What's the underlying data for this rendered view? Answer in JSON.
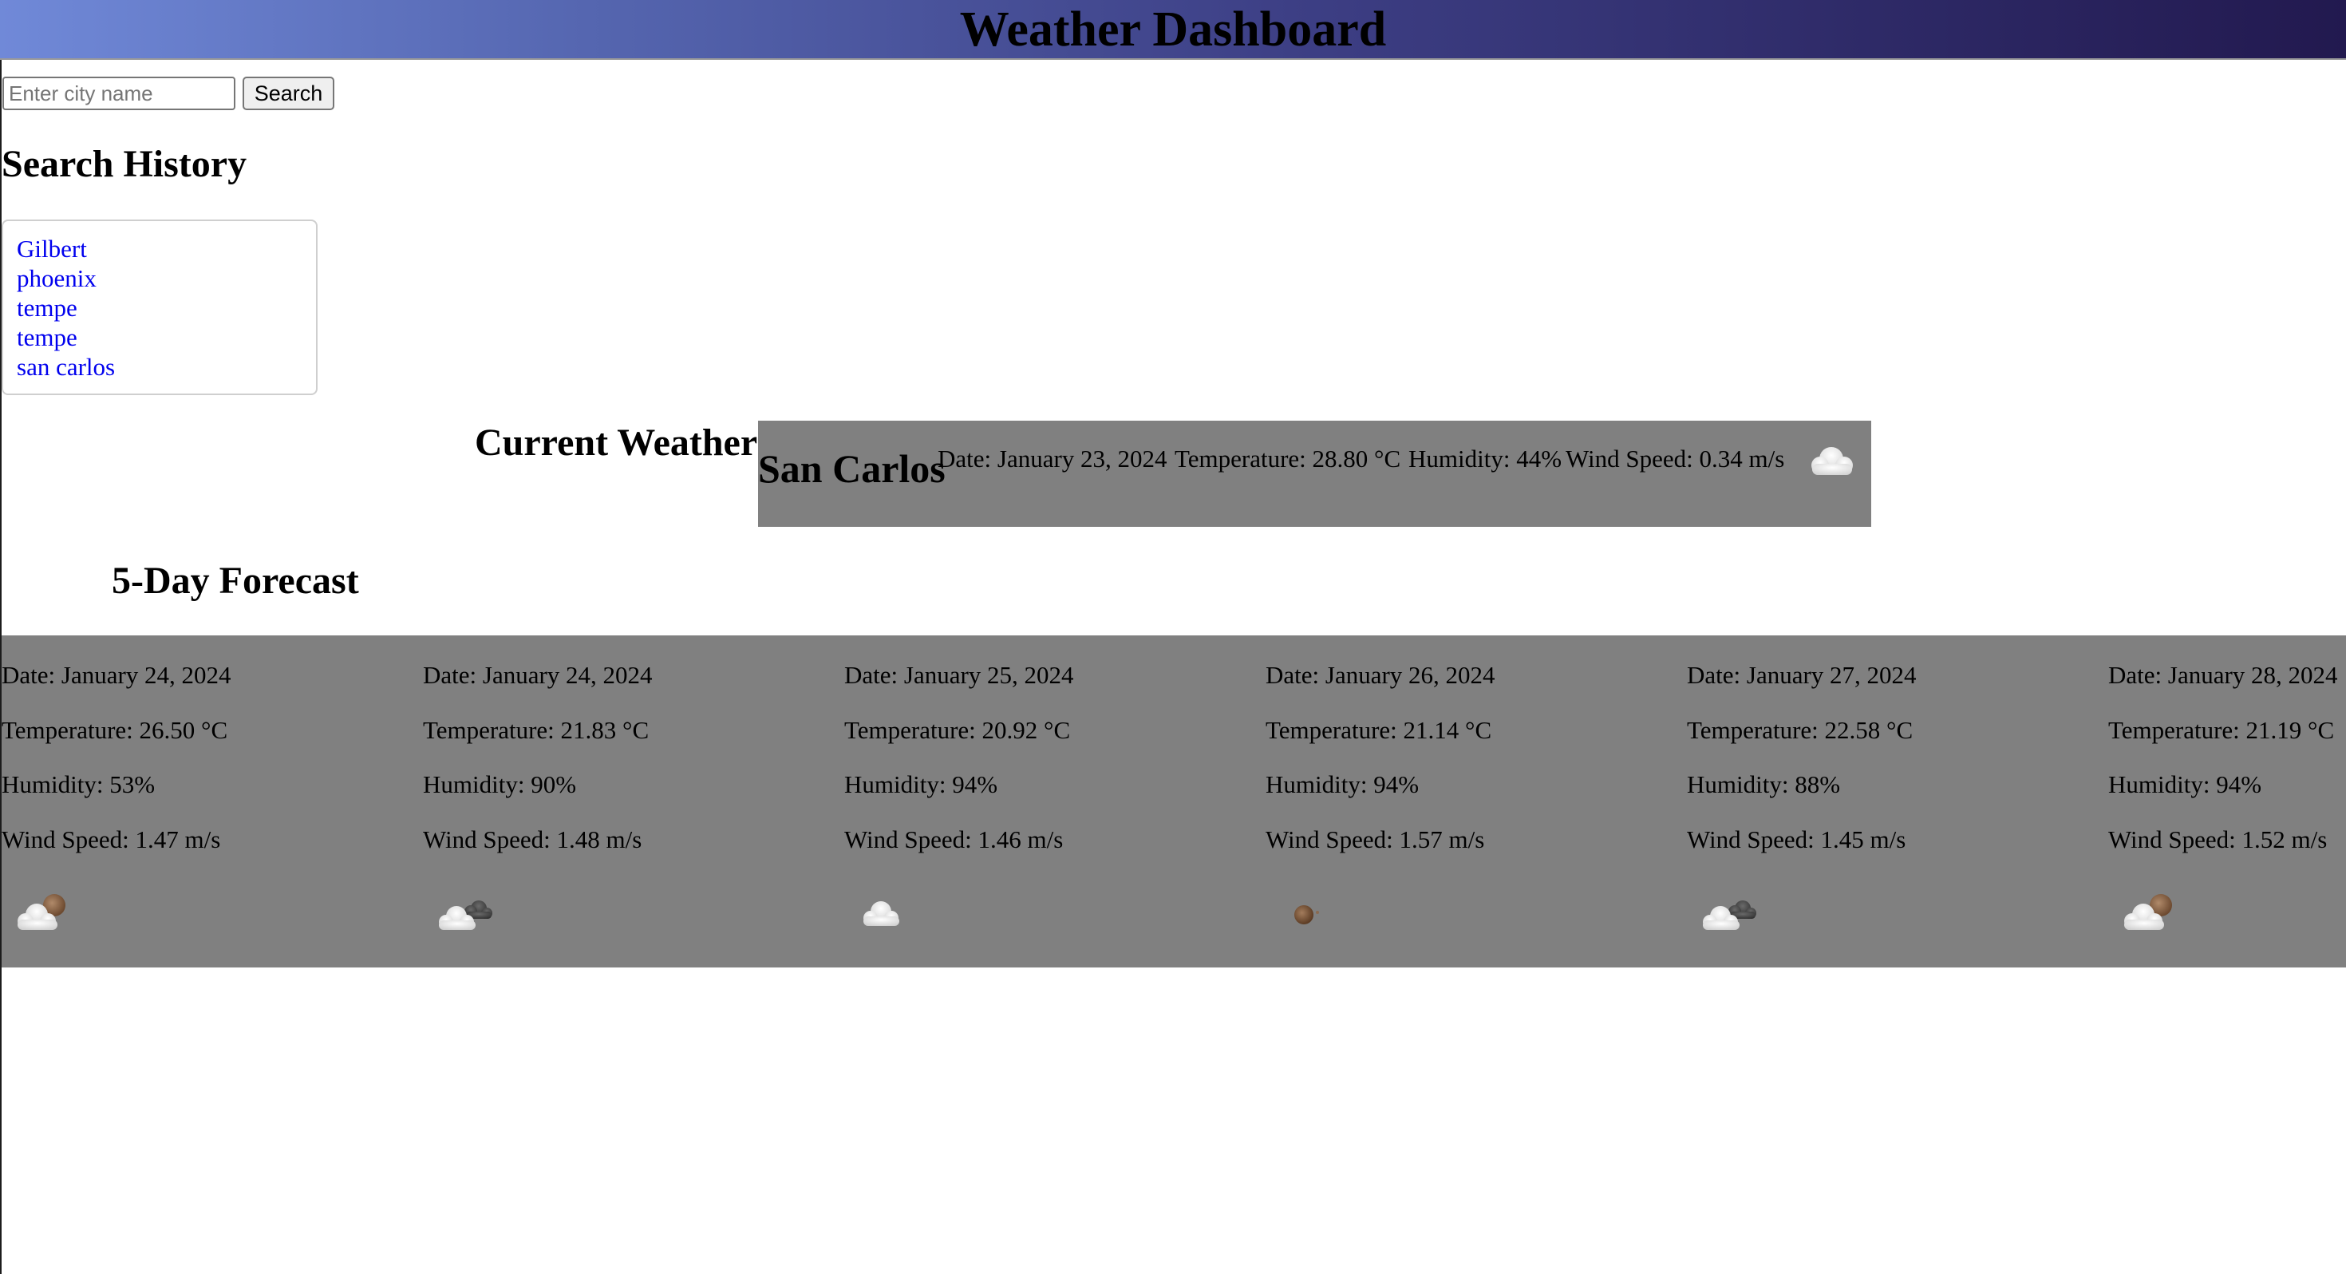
{
  "header": {
    "title": "Weather Dashboard"
  },
  "search": {
    "placeholder": "Enter city name",
    "value": "",
    "button_label": "Search"
  },
  "history": {
    "heading": "Search History",
    "items": [
      "Gilbert",
      "phoenix",
      "tempe",
      "tempe",
      "san carlos"
    ]
  },
  "current": {
    "heading": "Current Weather",
    "city": "San Carlos",
    "date": "Date: January 23, 2024",
    "temperature": "Temperature: 28.80 °C",
    "humidity": "Humidity: 44%",
    "wind": "Wind Speed: 0.34 m/s",
    "icon": "cloud-icon"
  },
  "forecast": {
    "heading": "5-Day Forecast",
    "days": [
      {
        "date": "Date: January 24, 2024",
        "temperature": "Temperature: 26.50 °C",
        "humidity": "Humidity: 53%",
        "wind": "Wind Speed: 1.47 m/s",
        "icon": "partly-cloudy-icon"
      },
      {
        "date": "Date: January 24, 2024",
        "temperature": "Temperature: 21.83 °C",
        "humidity": "Humidity: 90%",
        "wind": "Wind Speed: 1.48 m/s",
        "icon": "broken-clouds-icon"
      },
      {
        "date": "Date: January 25, 2024",
        "temperature": "Temperature: 20.92 °C",
        "humidity": "Humidity: 94%",
        "wind": "Wind Speed: 1.46 m/s",
        "icon": "cloud-icon"
      },
      {
        "date": "Date: January 26, 2024",
        "temperature": "Temperature: 21.14 °C",
        "humidity": "Humidity: 94%",
        "wind": "Wind Speed: 1.57 m/s",
        "icon": "clear-night-icon"
      },
      {
        "date": "Date: January 27, 2024",
        "temperature": "Temperature: 22.58 °C",
        "humidity": "Humidity: 88%",
        "wind": "Wind Speed: 1.45 m/s",
        "icon": "broken-clouds-icon"
      },
      {
        "date": "Date: January 28, 2024",
        "temperature": "Temperature: 21.19 °C",
        "humidity": "Humidity: 94%",
        "wind": "Wind Speed: 1.52 m/s",
        "icon": "partly-cloudy-icon"
      }
    ]
  },
  "colors": {
    "header_gradient_start": "#7089d8",
    "header_gradient_end": "#22194f",
    "card_background": "#808080",
    "link": "#0000ee"
  }
}
